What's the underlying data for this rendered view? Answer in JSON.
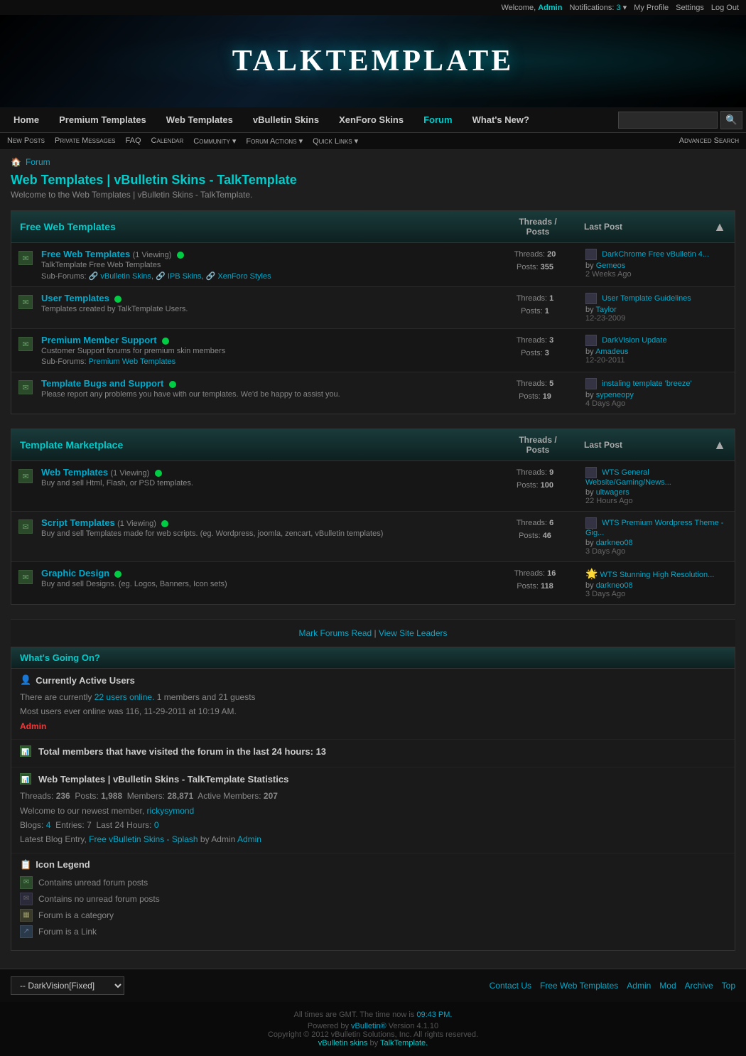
{
  "topbar": {
    "welcome": "Welcome,",
    "username": "Admin",
    "notifications_label": "Notifications:",
    "notifications_count": "3",
    "my_profile": "My Profile",
    "settings": "Settings",
    "logout": "Log Out"
  },
  "site_title_part1": "Talk",
  "site_title_part2": "Template",
  "main_nav": {
    "home": "Home",
    "premium_templates": "Premium Templates",
    "web_templates": "Web Templates",
    "vbulletin_skins": "vBulletin Skins",
    "xenforo_skins": "XenForo Skins",
    "forum": "Forum",
    "whats_new": "What's New?"
  },
  "sub_nav": {
    "new_posts": "New Posts",
    "private_messages": "Private Messages",
    "faq": "FAQ",
    "calendar": "Calendar",
    "community": "Community",
    "forum_actions": "Forum Actions",
    "quick_links": "Quick Links",
    "advanced_search": "Advanced Search"
  },
  "breadcrumb": {
    "home": "Forum"
  },
  "page_title": "Web Templates | vBulletin Skins - TalkTemplate",
  "page_subtitle": "Welcome to the Web Templates | vBulletin Skins - TalkTemplate.",
  "free_section": {
    "title": "Free Web Templates",
    "col_threads": "Threads /",
    "col_posts": "Posts",
    "col_last_post": "Last Post",
    "forums": [
      {
        "name": "Free Web Templates",
        "viewing": "(1 Viewing)",
        "desc": "TalkTemplate Free Web Templates",
        "subforums_label": "Sub-Forums:",
        "subforums": [
          "vBulletin Skins",
          "IPB Skins",
          "XenForo Styles"
        ],
        "threads": "20",
        "posts": "355",
        "last_post_title": "DarkChrome Free vBulletin 4...",
        "last_post_by": "Gemeos",
        "last_post_date": "2 Weeks Ago"
      },
      {
        "name": "User Templates",
        "viewing": "",
        "desc": "Templates created by TalkTemplate Users.",
        "subforums_label": "",
        "subforums": [],
        "threads": "1",
        "posts": "1",
        "last_post_title": "User Template Guidelines",
        "last_post_by": "Taylor",
        "last_post_date": "12-23-2009"
      },
      {
        "name": "Premium Member Support",
        "viewing": "",
        "desc": "Customer Support forums for premium skin members",
        "subforums_label": "Sub-Forums:",
        "subforums": [
          "Premium Web Templates"
        ],
        "threads": "3",
        "posts": "3",
        "last_post_title": "DarkVision Update",
        "last_post_by": "Amadeus",
        "last_post_date": "12-20-2011"
      },
      {
        "name": "Template Bugs and Support",
        "viewing": "",
        "desc": "Please report any problems you have with our templates. We'd be happy to assist you.",
        "subforums_label": "",
        "subforums": [],
        "threads": "5",
        "posts": "19",
        "last_post_title": "instaling template 'breeze'",
        "last_post_by": "sypeneopy",
        "last_post_date": "4 Days Ago"
      }
    ]
  },
  "marketplace_section": {
    "title": "Template Marketplace",
    "col_threads": "Threads /",
    "col_posts": "Posts",
    "col_last_post": "Last Post",
    "forums": [
      {
        "name": "Web Templates",
        "viewing": "(1 Viewing)",
        "desc": "Buy and sell Html, Flash, or PSD templates.",
        "subforums_label": "",
        "subforums": [],
        "threads": "9",
        "posts": "100",
        "last_post_title": "WTS General Website/Gaming/News...",
        "last_post_by": "ultwagers",
        "last_post_date": "22 Hours Ago"
      },
      {
        "name": "Script Templates",
        "viewing": "(1 Viewing)",
        "desc": "Buy and sell Templates made for web scripts. (eg. Wordpress, joomla, zencart, vBulletin templates)",
        "subforums_label": "",
        "subforums": [],
        "threads": "6",
        "posts": "46",
        "last_post_title": "WTS Premium Wordpress Theme - Gig...",
        "last_post_by": "darkneo08",
        "last_post_date": "3 Days Ago"
      },
      {
        "name": "Graphic Design",
        "viewing": "",
        "desc": "Buy and sell Designs. (eg. Logos, Banners, Icon sets)",
        "subforums_label": "",
        "subforums": [],
        "threads": "16",
        "posts": "118",
        "last_post_title": "WTS Stunning High Resolution...",
        "last_post_by": "darkneo08",
        "last_post_date": "3 Days Ago"
      }
    ]
  },
  "forum_actions_bar": {
    "mark_forums_read": "Mark Forums Read",
    "view_site_leaders": "View Site Leaders"
  },
  "whats_going_on": {
    "title": "What's Going On?",
    "active_users_title": "Currently Active Users",
    "active_users_text": "There are currently",
    "active_count": "22 users online.",
    "members_guests": "1 members and 21 guests",
    "most_users_text": "Most users ever online was 116, 11-29-2011 at 10:19 AM.",
    "active_member": "Admin",
    "total_members_title": "Total members that have visited the forum in the last 24 hours: 13",
    "stats_title": "Web Templates | vBulletin Skins - TalkTemplate Statistics",
    "threads": "236",
    "posts": "1,988",
    "members": "28,871",
    "active_members": "207",
    "newest_member_label": "Welcome to our newest member,",
    "newest_member": "rickysymond",
    "blogs_label": "Blogs:",
    "blogs_count": "4",
    "entries_label": "Entries:",
    "entries_count": "7",
    "last24_label": "Last 24 Hours:",
    "last24_count": "0",
    "latest_blog_label": "Latest Blog Entry,",
    "latest_blog_title": "Free vBulletin Skins - Splash",
    "latest_blog_by": "by Admin"
  },
  "icon_legend": {
    "title": "Icon Legend",
    "items": [
      "Contains unread forum posts",
      "Contains no unread forum posts",
      "Forum is a category",
      "Forum is a Link"
    ]
  },
  "footer": {
    "style_select": "-- DarkVision[Fixed]",
    "links": [
      "Contact Us",
      "Free Web Templates",
      "Admin",
      "Mod",
      "Archive",
      "Top"
    ],
    "timezone": "All times are GMT. The time now is",
    "time": "09:43 PM.",
    "powered_by": "Powered by vBulletin® Version 4.1.10",
    "copyright": "Copyright © 2012 vBulletin Solutions, Inc. All rights reserved.",
    "vb_skins": "vBulletin skins",
    "by": "by",
    "talktemplate": "TalkTemplate."
  }
}
